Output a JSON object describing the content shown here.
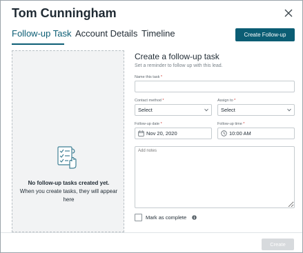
{
  "header": {
    "title": "Tom Cunningham",
    "close_icon": "close-icon"
  },
  "tabs": [
    {
      "label": "Follow-up Task",
      "active": true
    },
    {
      "label": "Account Details",
      "active": false
    },
    {
      "label": "Timeline",
      "active": false
    }
  ],
  "actions": {
    "create_followup_label": "Create Follow-up"
  },
  "empty_state": {
    "icon": "task-list-icon",
    "title": "No follow-up tasks created yet.",
    "subtitle": "When you create tasks, they will appear here"
  },
  "form": {
    "title": "Create a follow-up task",
    "subtitle": "Set a reminder to follow up with this lead.",
    "task_name": {
      "label": "Name this task",
      "required_mark": "*",
      "value": ""
    },
    "contact_method": {
      "label": "Contact method",
      "required_mark": "*",
      "value": "Select"
    },
    "assign_to": {
      "label": "Assign to",
      "required_mark": "*",
      "value": "Select"
    },
    "followup_date": {
      "label": "Follow-up date",
      "required_mark": "*",
      "value": "Nov 20, 2020",
      "icon": "calendar-icon"
    },
    "followup_time": {
      "label": "Follow-up time",
      "required_mark": "*",
      "value": "10:00 AM",
      "icon": "clock-icon"
    },
    "notes": {
      "placeholder": "Add notes"
    },
    "mark_complete": {
      "label": "Mark as complete",
      "checked": false,
      "info_icon": "info-icon"
    }
  },
  "footer": {
    "create_label": "Create"
  },
  "colors": {
    "accent": "#0b5d74",
    "required": "#d0342c",
    "disabled_button": "#d7dadd"
  }
}
